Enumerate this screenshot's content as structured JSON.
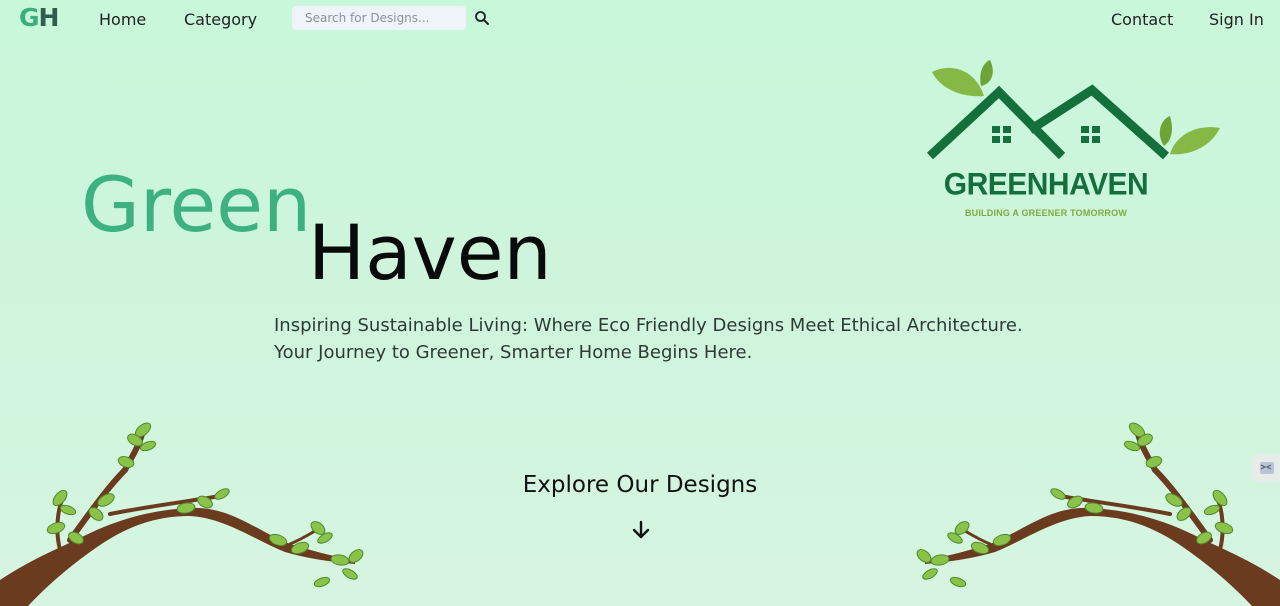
{
  "nav": {
    "brand_g": "G",
    "brand_h": "H",
    "home": "Home",
    "category": "Category",
    "search_placeholder": "Search for Designs...",
    "contact": "Contact",
    "sign_in": "Sign In"
  },
  "hero": {
    "title_green": "Green",
    "title_haven": "Haven",
    "tagline_line1": "Inspiring Sustainable Living: Where Eco Friendly Designs Meet Ethical Architecture.",
    "tagline_line2": "Your Journey to Greener, Smarter Home Begins Here."
  },
  "logo": {
    "name": "GREENHAVEN",
    "subtitle": "BUILDING A GREENER TOMORROW"
  },
  "explore": {
    "label": "Explore Our Designs"
  },
  "colors": {
    "background": "#c8f7da",
    "brand_green": "#3eb181",
    "logo_dark_green": "#136f3b",
    "leaf_green": "#7aad3f"
  },
  "icons": {
    "search": "search-icon",
    "down_arrow": "arrow-down-icon",
    "side_widget": "side-widget-icon"
  }
}
